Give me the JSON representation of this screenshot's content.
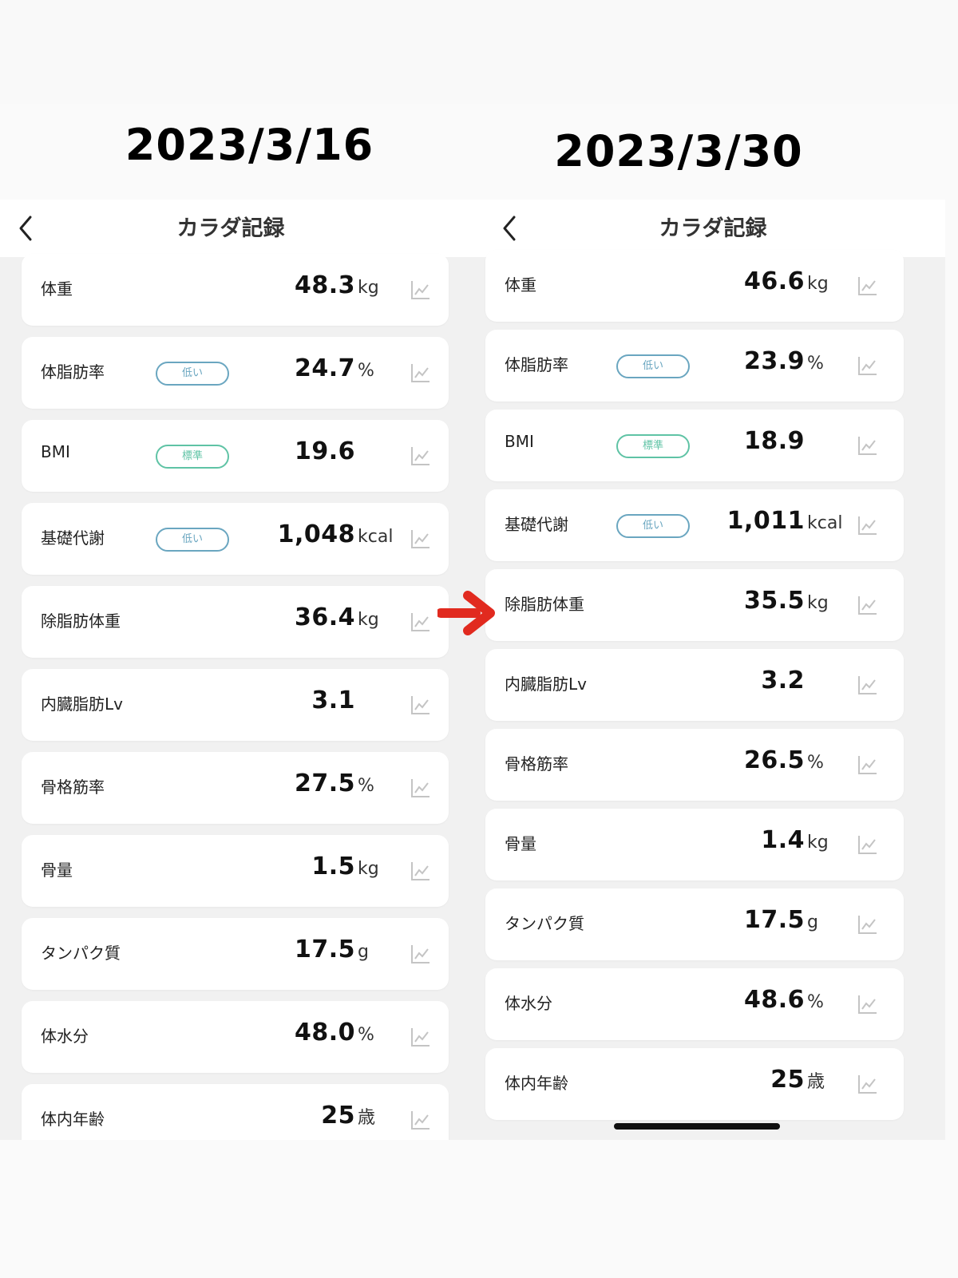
{
  "left": {
    "date": "2023/3/16",
    "nav_title": "カラダ記録",
    "rows": [
      {
        "label": "体重",
        "value": "48.3",
        "unit": "kg",
        "badge": ""
      },
      {
        "label": "体脂肪率",
        "value": "24.7",
        "unit": "%",
        "badge": "低い"
      },
      {
        "label": "BMI",
        "value": "19.6",
        "unit": "",
        "badge": "標準"
      },
      {
        "label": "基礎代謝",
        "value": "1,048",
        "unit": "kcal",
        "badge": "低い"
      },
      {
        "label": "除脂肪体重",
        "value": "36.4",
        "unit": "kg",
        "badge": ""
      },
      {
        "label": "内臓脂肪Lv",
        "value": "3.1",
        "unit": "",
        "badge": ""
      },
      {
        "label": "骨格筋率",
        "value": "27.5",
        "unit": "%",
        "badge": ""
      },
      {
        "label": "骨量",
        "value": "1.5",
        "unit": "kg",
        "badge": ""
      },
      {
        "label": "タンパク質",
        "value": "17.5",
        "unit": "g",
        "badge": ""
      },
      {
        "label": "体水分",
        "value": "48.0",
        "unit": "%",
        "badge": ""
      },
      {
        "label": "体内年齢",
        "value": "25",
        "unit": "歳",
        "badge": ""
      }
    ]
  },
  "right": {
    "date": "2023/3/30",
    "nav_title": "カラダ記録",
    "rows": [
      {
        "label": "体重",
        "value": "46.6",
        "unit": "kg",
        "badge": ""
      },
      {
        "label": "体脂肪率",
        "value": "23.9",
        "unit": "%",
        "badge": "低い"
      },
      {
        "label": "BMI",
        "value": "18.9",
        "unit": "",
        "badge": "標準"
      },
      {
        "label": "基礎代謝",
        "value": "1,011",
        "unit": "kcal",
        "badge": "低い"
      },
      {
        "label": "除脂肪体重",
        "value": "35.5",
        "unit": "kg",
        "badge": ""
      },
      {
        "label": "内臓脂肪Lv",
        "value": "3.2",
        "unit": "",
        "badge": ""
      },
      {
        "label": "骨格筋率",
        "value": "26.5",
        "unit": "%",
        "badge": ""
      },
      {
        "label": "骨量",
        "value": "1.4",
        "unit": "kg",
        "badge": ""
      },
      {
        "label": "タンパク質",
        "value": "17.5",
        "unit": "g",
        "badge": ""
      },
      {
        "label": "体水分",
        "value": "48.6",
        "unit": "%",
        "badge": ""
      },
      {
        "label": "体内年齢",
        "value": "25",
        "unit": "歳",
        "badge": ""
      }
    ]
  },
  "icons": {
    "back": "chevron-left-icon",
    "row_action": "line-chart-icon",
    "annotation": "red-arrow-icon"
  },
  "colors": {
    "badge_low": "#6aa6c0",
    "badge_standard": "#5fc3a5",
    "arrow": "#e12a1f",
    "card_bg": "#ffffff",
    "panel_bg": "#f1f1f1"
  }
}
